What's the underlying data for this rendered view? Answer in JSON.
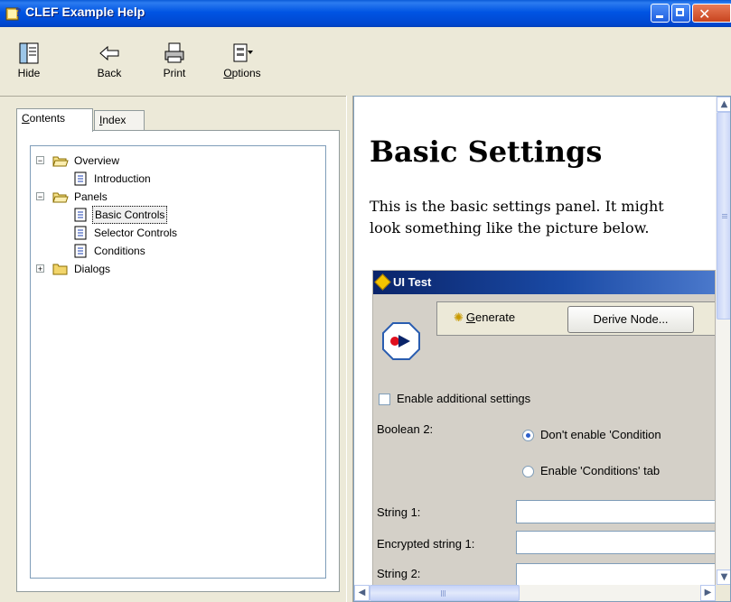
{
  "window": {
    "title": "CLEF Example Help",
    "icon": "help-book-icon",
    "controls": [
      "minimize-icon",
      "maximize-icon",
      "close-icon"
    ],
    "close_glyph": "✕"
  },
  "toolbar": {
    "hide_label": "Hide",
    "back_label": "Back",
    "print_label": "Print",
    "options_prefix": "O",
    "options_rest": "ptions"
  },
  "nav": {
    "tab_contents_prefix": "C",
    "tab_contents_rest": "ontents",
    "tab_index_prefix": "I",
    "tab_index_rest": "ndex",
    "tree": [
      {
        "label": "Overview",
        "type": "folder-open",
        "expander": "−"
      },
      {
        "label": "Introduction",
        "type": "page"
      },
      {
        "label": "Panels",
        "type": "folder-open",
        "expander": "−"
      },
      {
        "label": "Basic Controls",
        "type": "page",
        "selected": true
      },
      {
        "label": "Selector Controls",
        "type": "page"
      },
      {
        "label": "Conditions",
        "type": "page"
      },
      {
        "label": "Dialogs",
        "type": "folder-closed",
        "expander": "+"
      }
    ]
  },
  "content": {
    "heading": "Basic Settings",
    "paragraph": "This is the basic settings panel. It might look something like the picture below.",
    "dialog": {
      "title": "UI Test",
      "generate_prefix": "G",
      "generate_rest": "enerate",
      "derive_label": "Derive Node...",
      "checkbox_label": "Enable additional settings",
      "boolean_label": "Boolean 2:",
      "radio1_label": "Don't enable 'Condition",
      "radio2_label": "Enable 'Conditions' tab",
      "string1_label": "String 1:",
      "encrypted_label": "Encrypted string 1:",
      "string2_label": "String 2:"
    },
    "scroll": {
      "up": "▲",
      "down": "▼",
      "left": "◀",
      "right": "▶"
    }
  },
  "colors": {
    "titlebar": "#0054e3",
    "dialog_title": "#0a246a",
    "selected_outline": "#000000"
  }
}
